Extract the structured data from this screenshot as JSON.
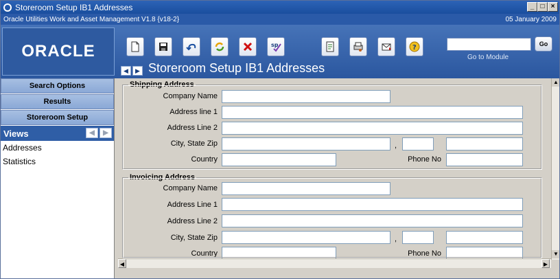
{
  "window": {
    "title": "Storeroom Setup IB1 Addresses",
    "app_name": "Oracle Utilities Work and Asset Management V1.8 {v18-2}",
    "date": "05 January  2009"
  },
  "header": {
    "logo_text": "ORACLE",
    "page_title": "Storeroom Setup IB1 Addresses",
    "go_button": "Go",
    "goto_label": "Go to Module",
    "goto_value": ""
  },
  "toolbar": {
    "icons": [
      "new-document-icon",
      "save-icon",
      "undo-icon",
      "refresh-icon",
      "delete-icon",
      "spell-check-icon",
      "report-icon",
      "print-icon",
      "mail-icon",
      "help-icon"
    ]
  },
  "sidebar": {
    "search_options": "Search Options",
    "results": "Results",
    "storeroom_setup": "Storeroom Setup",
    "views_label": "Views",
    "views": [
      "Addresses",
      "Statistics"
    ]
  },
  "shipping": {
    "legend": "Shipping Address",
    "company_name_label": "Company Name",
    "address1_label": "Address line 1",
    "address2_label": "Address Line 2",
    "city_state_zip_label": "City, State  Zip",
    "country_label": "Country",
    "phone_label": "Phone No",
    "comma": ",",
    "company_name": "",
    "address1": "",
    "address2": "",
    "city": "",
    "state": "",
    "zip": "",
    "country": "",
    "phone": ""
  },
  "invoicing": {
    "legend": "Invoicing Address",
    "company_name_label": "Company Name",
    "address1_label": "Address Line 1",
    "address2_label": "Address Line 2",
    "city_state_zip_label": "City, State  Zip",
    "country_label": "Country",
    "phone_label": "Phone No",
    "comma": ",",
    "company_name": "",
    "address1": "",
    "address2": "",
    "city": "",
    "state": "",
    "zip": "",
    "country": "",
    "phone": ""
  },
  "colors": {
    "title_blue": "#2d63b6",
    "header_blue": "#4673b8",
    "sidebar_button": "#a7bfe2",
    "views_bar": "#2f5ea6"
  }
}
